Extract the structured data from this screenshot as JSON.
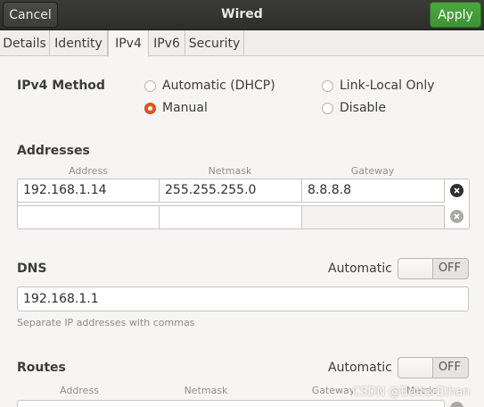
{
  "header": {
    "cancel": "Cancel",
    "title": "Wired",
    "apply": "Apply"
  },
  "tabs": [
    "Details",
    "Identity",
    "IPv4",
    "IPv6",
    "Security"
  ],
  "active_tab": "IPv4",
  "ipv4_method": {
    "label": "IPv4 Method",
    "options": [
      "Automatic (DHCP)",
      "Manual",
      "Link-Local Only",
      "Disable"
    ],
    "selected": "Manual"
  },
  "addresses": {
    "title": "Addresses",
    "columns": [
      "Address",
      "Netmask",
      "Gateway"
    ],
    "rows": [
      [
        "192.168.1.14",
        "255.255.255.0",
        "8.8.8.8"
      ],
      [
        "",
        "",
        ""
      ]
    ]
  },
  "dns": {
    "title": "DNS",
    "automatic_label": "Automatic",
    "toggle": "OFF",
    "value": "192.168.1.1",
    "hint": "Separate IP addresses with commas"
  },
  "routes": {
    "title": "Routes",
    "automatic_label": "Automatic",
    "toggle": "OFF",
    "columns": [
      "Address",
      "Netmask",
      "Gateway",
      "Metric"
    ]
  },
  "watermark": "CSDN @BetterEthan",
  "colors": {
    "accent_radio": "#e95420",
    "apply_green": "#4ba83d",
    "headerbar": "#333331"
  }
}
